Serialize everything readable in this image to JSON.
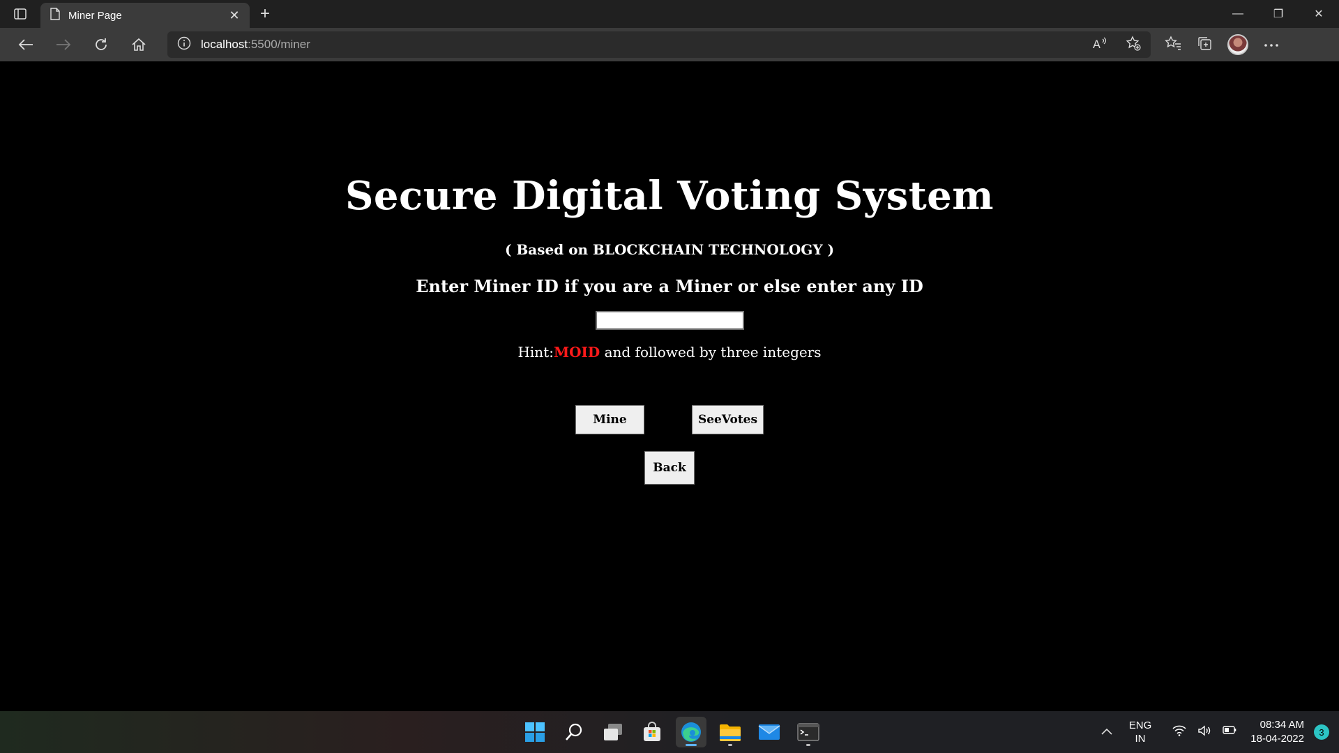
{
  "browser": {
    "tab_title": "Miner Page",
    "url_host": "localhost",
    "url_path": ":5500/miner",
    "controls": {
      "minimize": "—",
      "restore": "❐",
      "close": "✕",
      "new_tab": "+",
      "tab_close": "✕"
    }
  },
  "page": {
    "heading": "Secure Digital Voting System",
    "subheading": "( Based on BLOCKCHAIN TECHNOLOGY )",
    "prompt": "Enter Miner ID if you are a Miner or else enter any ID",
    "id_input_value": "",
    "hint_prefix": "Hint:",
    "hint_highlight": "MOID",
    "hint_suffix": " and followed by three integers",
    "buttons": {
      "mine": "Mine",
      "see_votes": "SeeVotes",
      "back": "Back"
    },
    "colors": {
      "background": "#000000",
      "text": "#ffffff",
      "hint_highlight": "#ff1a1a"
    }
  },
  "taskbar": {
    "language_line1": "ENG",
    "language_line2": "IN",
    "time": "08:34 AM",
    "date": "18-04-2022",
    "notification_count": "3",
    "apps": [
      "start-icon",
      "search-icon",
      "task-view-icon",
      "store-icon",
      "edge-icon",
      "file-explorer-icon",
      "mail-icon",
      "terminal-icon"
    ]
  }
}
